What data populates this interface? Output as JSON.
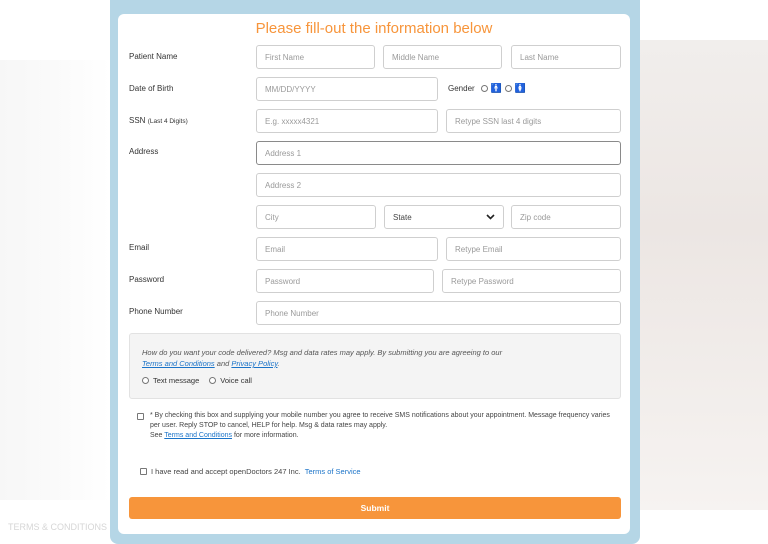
{
  "form": {
    "title": "Please fill-out the information below",
    "labels": {
      "patient_name": "Patient Name",
      "dob": "Date of Birth",
      "ssn": "SSN",
      "ssn_hint": "(Last 4 Digits)",
      "address": "Address",
      "email": "Email",
      "password": "Password",
      "phone": "Phone Number"
    },
    "placeholders": {
      "first_name": "First Name",
      "middle_name": "Middle Name",
      "last_name": "Last Name",
      "dob": "MM/DD/YYYY",
      "ssn": "E.g. xxxxx4321",
      "ssn_retype": "Retype SSN last 4 digits",
      "address1": "Address 1",
      "address2": "Address 2",
      "city": "City",
      "zip": "Zip code",
      "email": "Email",
      "email_retype": "Retype Email",
      "password": "Password",
      "password_retype": "Retype Password",
      "phone": "Phone Number"
    },
    "gender_label": "Gender",
    "state_select": {
      "selected": "State"
    },
    "delivery": {
      "question": "How do you want your code delivered? Msg and data rates may apply. By submitting you are agreeing to our",
      "terms_link": "Terms and Conditions",
      "and_text": "and",
      "privacy_link": "Privacy Policy",
      "period": ".",
      "option_text": "Text message",
      "option_voice": "Voice call"
    },
    "sms_consent": {
      "text": "* By checking this box and supplying your mobile number you agree to receive SMS notifications about your appointment. Message frequency varies per user. Reply STOP to cancel, HELP for help. Msg & data rates may apply.",
      "see": "See",
      "terms_link": "Terms and Conditions",
      "more": "for more information."
    },
    "tos": {
      "text": "I have read and accept openDoctors 247 Inc.",
      "link": "Terms of Service"
    },
    "submit_label": "Submit"
  },
  "background": {
    "footer_text": "TERMS & CONDITIONS   PRIVACY"
  }
}
